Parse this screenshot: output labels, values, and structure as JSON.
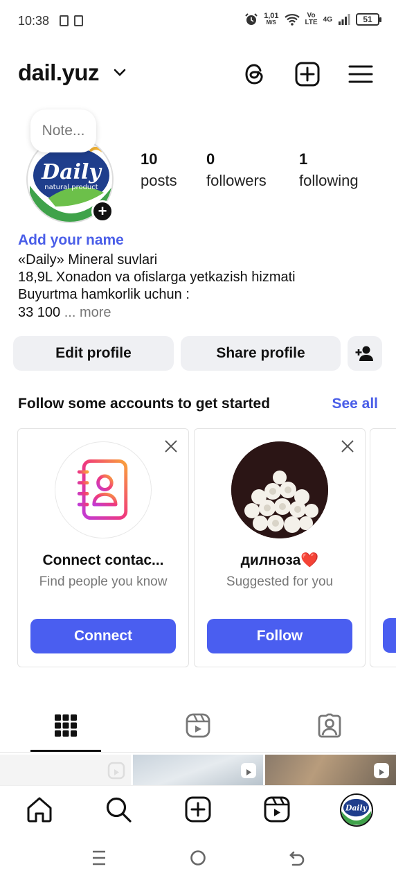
{
  "status_bar": {
    "time": "10:38",
    "speed_value": "1,01",
    "speed_unit": "M/S",
    "volte_top": "Vo",
    "volte_bottom": "LTE",
    "network": "4G",
    "battery": "51"
  },
  "header": {
    "username": "dail.yuz",
    "icons": [
      "threads-icon",
      "create-post-icon",
      "menu-icon"
    ]
  },
  "profile": {
    "note_placeholder": "Note...",
    "stats": [
      {
        "value": "10",
        "label": "posts"
      },
      {
        "value": "0",
        "label": "followers"
      },
      {
        "value": "1",
        "label": "following"
      }
    ],
    "add_name": "Add your name",
    "bio": [
      "«Daily» Mineral suvlari",
      "18,9L Xonadon va ofislarga yetkazish hizmati",
      "Buyurtma hamkorlik uchun :",
      "33 100"
    ],
    "more": " ... more",
    "logo_text": "Daily",
    "logo_sub": "natural product"
  },
  "actions": {
    "edit_profile": "Edit profile",
    "share_profile": "Share profile"
  },
  "suggestions": {
    "title": "Follow some accounts to get started",
    "see_all": "See all",
    "cards": [
      {
        "title": "Connect contac...",
        "subtitle": "Find people you know",
        "button": "Connect"
      },
      {
        "title": "дилноза❤️",
        "subtitle": "Suggested for you",
        "button": "Follow"
      }
    ]
  },
  "tabs": [
    "grid-icon",
    "reels-icon",
    "tagged-icon"
  ],
  "bottom_nav": [
    "home-icon",
    "search-icon",
    "create-icon",
    "reels-icon",
    "profile-avatar"
  ],
  "colors": {
    "accent": "#4a5ef0",
    "link": "#4a5ee8",
    "button_bg": "#eff0f3"
  }
}
